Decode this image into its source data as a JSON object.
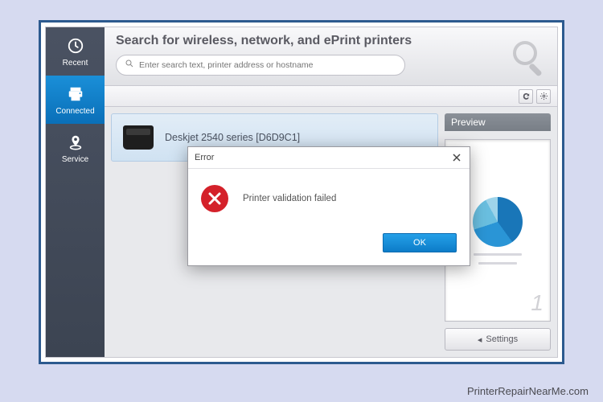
{
  "sidebar": {
    "items": [
      {
        "label": "Recent"
      },
      {
        "label": "Connected"
      },
      {
        "label": "Service"
      }
    ]
  },
  "header": {
    "title": "Search for wireless, network, and ePrint printers",
    "search_placeholder": "Enter search text, printer address or hostname"
  },
  "printer": {
    "name": "Deskjet 2540 series [D6D9C1]"
  },
  "preview": {
    "title": "Preview",
    "page_number": "1",
    "settings_label": "Settings"
  },
  "dialog": {
    "title": "Error",
    "message": "Printer validation failed",
    "ok_label": "OK"
  },
  "watermark": "PrinterRepairNearMe.com"
}
